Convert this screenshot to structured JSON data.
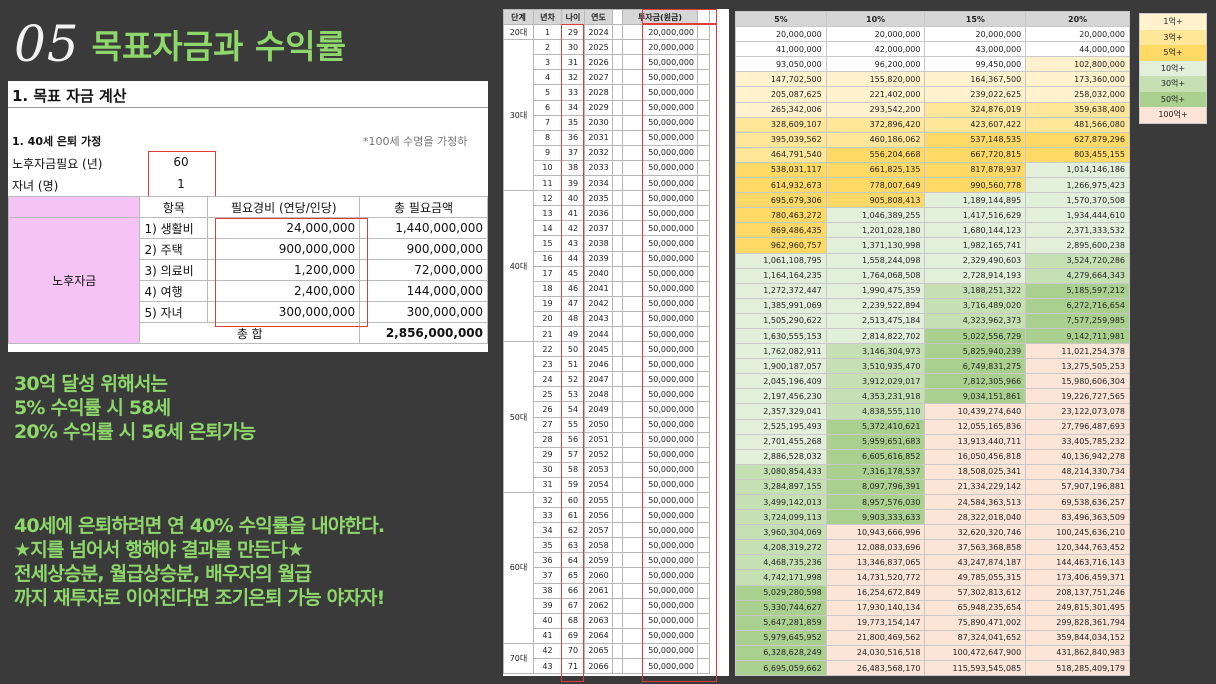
{
  "header": {
    "number": "05",
    "title": "목표자금과 수익률"
  },
  "goal_panel": {
    "section_title": "1. 목표 자금 계산",
    "subtitle": "1. 40세 은퇴 가정",
    "note": "*100세 수명을 가정하",
    "inputs": [
      {
        "label": "노후자금필요 (년)",
        "value": "60"
      },
      {
        "label": "자녀 (명)",
        "value": "1"
      }
    ],
    "table": {
      "headers": [
        "항목",
        "필요경비 (연당/인당)",
        "총 필요금액"
      ],
      "group_label": "노후자금",
      "rows": [
        {
          "item": "1) 생활비",
          "cost": "24,000,000",
          "total": "1,440,000,000"
        },
        {
          "item": "2) 주택",
          "cost": "900,000,000",
          "total": "900,000,000"
        },
        {
          "item": "3) 의료비",
          "cost": "1,200,000",
          "total": "72,000,000"
        },
        {
          "item": "4) 여행",
          "cost": "2,400,000",
          "total": "144,000,000"
        },
        {
          "item": "5) 자녀",
          "cost": "300,000,000",
          "total": "300,000,000"
        }
      ],
      "total_label": "총 합",
      "total_value": "2,856,000,000"
    }
  },
  "message": {
    "block1": [
      "30억 달성 위해서는",
      "5% 수익률 시 58세",
      "20% 수익률 시 56세 은퇴가능"
    ],
    "block2": [
      "40세에 은퇴하려면 연 40% 수익률을 내야한다.",
      "★지를 넘어서 행해야 결과를 만든다★",
      "전세상승분, 월급상승분, 배우자의 월급",
      "까지 재투자로 이어진다면 조기은퇴 가능 야자자!"
    ]
  },
  "schedule": {
    "headers": [
      "단계",
      "년차",
      "나이",
      "연도",
      "투자금(원금)"
    ],
    "stages": [
      {
        "label": "20대",
        "rows": 1
      },
      {
        "label": "30대",
        "rows": 10
      },
      {
        "label": "40대",
        "rows": 10
      },
      {
        "label": "50대",
        "rows": 10
      },
      {
        "label": "60대",
        "rows": 10
      },
      {
        "label": "70대",
        "rows": 2
      }
    ],
    "rows": [
      [
        "1",
        "29",
        "2024",
        "20,000,000"
      ],
      [
        "2",
        "30",
        "2025",
        "20,000,000"
      ],
      [
        "3",
        "31",
        "2026",
        "50,000,000"
      ],
      [
        "4",
        "32",
        "2027",
        "50,000,000"
      ],
      [
        "5",
        "33",
        "2028",
        "50,000,000"
      ],
      [
        "6",
        "34",
        "2029",
        "50,000,000"
      ],
      [
        "7",
        "35",
        "2030",
        "50,000,000"
      ],
      [
        "8",
        "36",
        "2031",
        "50,000,000"
      ],
      [
        "9",
        "37",
        "2032",
        "50,000,000"
      ],
      [
        "10",
        "38",
        "2033",
        "50,000,000"
      ],
      [
        "11",
        "39",
        "2034",
        "50,000,000"
      ],
      [
        "12",
        "40",
        "2035",
        "50,000,000"
      ],
      [
        "13",
        "41",
        "2036",
        "50,000,000"
      ],
      [
        "14",
        "42",
        "2037",
        "50,000,000"
      ],
      [
        "15",
        "43",
        "2038",
        "50,000,000"
      ],
      [
        "16",
        "44",
        "2039",
        "50,000,000"
      ],
      [
        "17",
        "45",
        "2040",
        "50,000,000"
      ],
      [
        "18",
        "46",
        "2041",
        "50,000,000"
      ],
      [
        "19",
        "47",
        "2042",
        "50,000,000"
      ],
      [
        "20",
        "48",
        "2043",
        "50,000,000"
      ],
      [
        "21",
        "49",
        "2044",
        "50,000,000"
      ],
      [
        "22",
        "50",
        "2045",
        "50,000,000"
      ],
      [
        "23",
        "51",
        "2046",
        "50,000,000"
      ],
      [
        "24",
        "52",
        "2047",
        "50,000,000"
      ],
      [
        "25",
        "53",
        "2048",
        "50,000,000"
      ],
      [
        "26",
        "54",
        "2049",
        "50,000,000"
      ],
      [
        "27",
        "55",
        "2050",
        "50,000,000"
      ],
      [
        "28",
        "56",
        "2051",
        "50,000,000"
      ],
      [
        "29",
        "57",
        "2052",
        "50,000,000"
      ],
      [
        "30",
        "58",
        "2053",
        "50,000,000"
      ],
      [
        "31",
        "59",
        "2054",
        "50,000,000"
      ],
      [
        "32",
        "60",
        "2055",
        "50,000,000"
      ],
      [
        "33",
        "61",
        "2056",
        "50,000,000"
      ],
      [
        "34",
        "62",
        "2057",
        "50,000,000"
      ],
      [
        "35",
        "63",
        "2058",
        "50,000,000"
      ],
      [
        "36",
        "64",
        "2059",
        "50,000,000"
      ],
      [
        "37",
        "65",
        "2060",
        "50,000,000"
      ],
      [
        "38",
        "66",
        "2061",
        "50,000,000"
      ],
      [
        "39",
        "67",
        "2062",
        "50,000,000"
      ],
      [
        "40",
        "68",
        "2063",
        "50,000,000"
      ],
      [
        "41",
        "69",
        "2064",
        "50,000,000"
      ],
      [
        "42",
        "70",
        "2065",
        "50,000,000"
      ],
      [
        "43",
        "71",
        "2066",
        "50,000,000"
      ]
    ]
  },
  "returns": {
    "headers": [
      "5%",
      "10%",
      "15%",
      "20%"
    ],
    "rows": [
      [
        "20,000,000",
        "20,000,000",
        "20,000,000",
        "20,000,000"
      ],
      [
        "41,000,000",
        "42,000,000",
        "43,000,000",
        "44,000,000"
      ],
      [
        "93,050,000",
        "96,200,000",
        "99,450,000",
        "102,800,000"
      ],
      [
        "147,702,500",
        "155,820,000",
        "164,367,500",
        "173,360,000"
      ],
      [
        "205,087,625",
        "221,402,000",
        "239,022,625",
        "258,032,000"
      ],
      [
        "265,342,006",
        "293,542,200",
        "324,876,019",
        "359,638,400"
      ],
      [
        "328,609,107",
        "372,896,420",
        "423,607,422",
        "481,566,080"
      ],
      [
        "395,039,562",
        "460,186,062",
        "537,148,535",
        "627,879,296"
      ],
      [
        "464,791,540",
        "556,204,668",
        "667,720,815",
        "803,455,155"
      ],
      [
        "538,031,117",
        "661,825,135",
        "817,878,937",
        "1,014,146,186"
      ],
      [
        "614,932,673",
        "778,007,649",
        "990,560,778",
        "1,266,975,423"
      ],
      [
        "695,679,306",
        "905,808,413",
        "1,189,144,895",
        "1,570,370,508"
      ],
      [
        "780,463,272",
        "1,046,389,255",
        "1,417,516,629",
        "1,934,444,610"
      ],
      [
        "869,486,435",
        "1,201,028,180",
        "1,680,144,123",
        "2,371,333,532"
      ],
      [
        "962,960,757",
        "1,371,130,998",
        "1,982,165,741",
        "2,895,600,238"
      ],
      [
        "1,061,108,795",
        "1,558,244,098",
        "2,329,490,603",
        "3,524,720,286"
      ],
      [
        "1,164,164,235",
        "1,764,068,508",
        "2,728,914,193",
        "4,279,664,343"
      ],
      [
        "1,272,372,447",
        "1,990,475,359",
        "3,188,251,322",
        "5,185,597,212"
      ],
      [
        "1,385,991,069",
        "2,239,522,894",
        "3,716,489,020",
        "6,272,716,654"
      ],
      [
        "1,505,290,622",
        "2,513,475,184",
        "4,323,962,373",
        "7,577,259,985"
      ],
      [
        "1,630,555,153",
        "2,814,822,702",
        "5,022,556,729",
        "9,142,711,981"
      ],
      [
        "1,762,082,911",
        "3,146,304,973",
        "5,825,940,239",
        "11,021,254,378"
      ],
      [
        "1,900,187,057",
        "3,510,935,470",
        "6,749,831,275",
        "13,275,505,253"
      ],
      [
        "2,045,196,409",
        "3,912,029,017",
        "7,812,305,966",
        "15,980,606,304"
      ],
      [
        "2,197,456,230",
        "4,353,231,918",
        "9,034,151,861",
        "19,226,727,565"
      ],
      [
        "2,357,329,041",
        "4,838,555,110",
        "10,439,274,640",
        "23,122,073,078"
      ],
      [
        "2,525,195,493",
        "5,372,410,621",
        "12,055,165,836",
        "27,796,487,693"
      ],
      [
        "2,701,455,268",
        "5,959,651,683",
        "13,913,440,711",
        "33,405,785,232"
      ],
      [
        "2,886,528,032",
        "6,605,616,852",
        "16,050,456,818",
        "40,136,942,278"
      ],
      [
        "3,080,854,433",
        "7,316,178,537",
        "18,508,025,341",
        "48,214,330,734"
      ],
      [
        "3,284,897,155",
        "8,097,796,391",
        "21,334,229,142",
        "57,907,196,881"
      ],
      [
        "3,499,142,013",
        "8,957,576,030",
        "24,584,363,513",
        "69,538,636,257"
      ],
      [
        "3,724,099,113",
        "9,903,333,633",
        "28,322,018,040",
        "83,496,363,509"
      ],
      [
        "3,960,304,069",
        "10,943,666,996",
        "32,620,320,746",
        "100,245,636,210"
      ],
      [
        "4,208,319,272",
        "12,088,033,696",
        "37,563,368,858",
        "120,344,763,452"
      ],
      [
        "4,468,735,236",
        "13,346,837,065",
        "43,247,874,187",
        "144,463,716,143"
      ],
      [
        "4,742,171,998",
        "14,731,520,772",
        "49,785,055,315",
        "173,406,459,371"
      ],
      [
        "5,029,280,598",
        "16,254,672,849",
        "57,302,813,612",
        "208,137,751,246"
      ],
      [
        "5,330,744,627",
        "17,930,140,134",
        "65,948,235,654",
        "249,815,301,495"
      ],
      [
        "5,647,281,859",
        "19,773,154,147",
        "75,890,471,002",
        "299,828,361,794"
      ],
      [
        "5,979,645,952",
        "21,800,469,562",
        "87,324,041,652",
        "359,844,034,152"
      ],
      [
        "6,328,628,249",
        "24,030,516,518",
        "100,472,647,900",
        "431,862,840,983"
      ],
      [
        "6,695,059,662",
        "26,483,568,170",
        "115,593,545,085",
        "518,285,409,179"
      ]
    ]
  },
  "legend": {
    "items": [
      {
        "label": "1억+",
        "color": "#fff2cc"
      },
      {
        "label": "3억+",
        "color": "#ffe699"
      },
      {
        "label": "5억+",
        "color": "#ffd966"
      },
      {
        "label": "10억+",
        "color": "#e2efda"
      },
      {
        "label": "30억+",
        "color": "#c6e0b4"
      },
      {
        "label": "50억+",
        "color": "#a9d08e"
      },
      {
        "label": "100억+",
        "color": "#fce4d6"
      }
    ]
  }
}
